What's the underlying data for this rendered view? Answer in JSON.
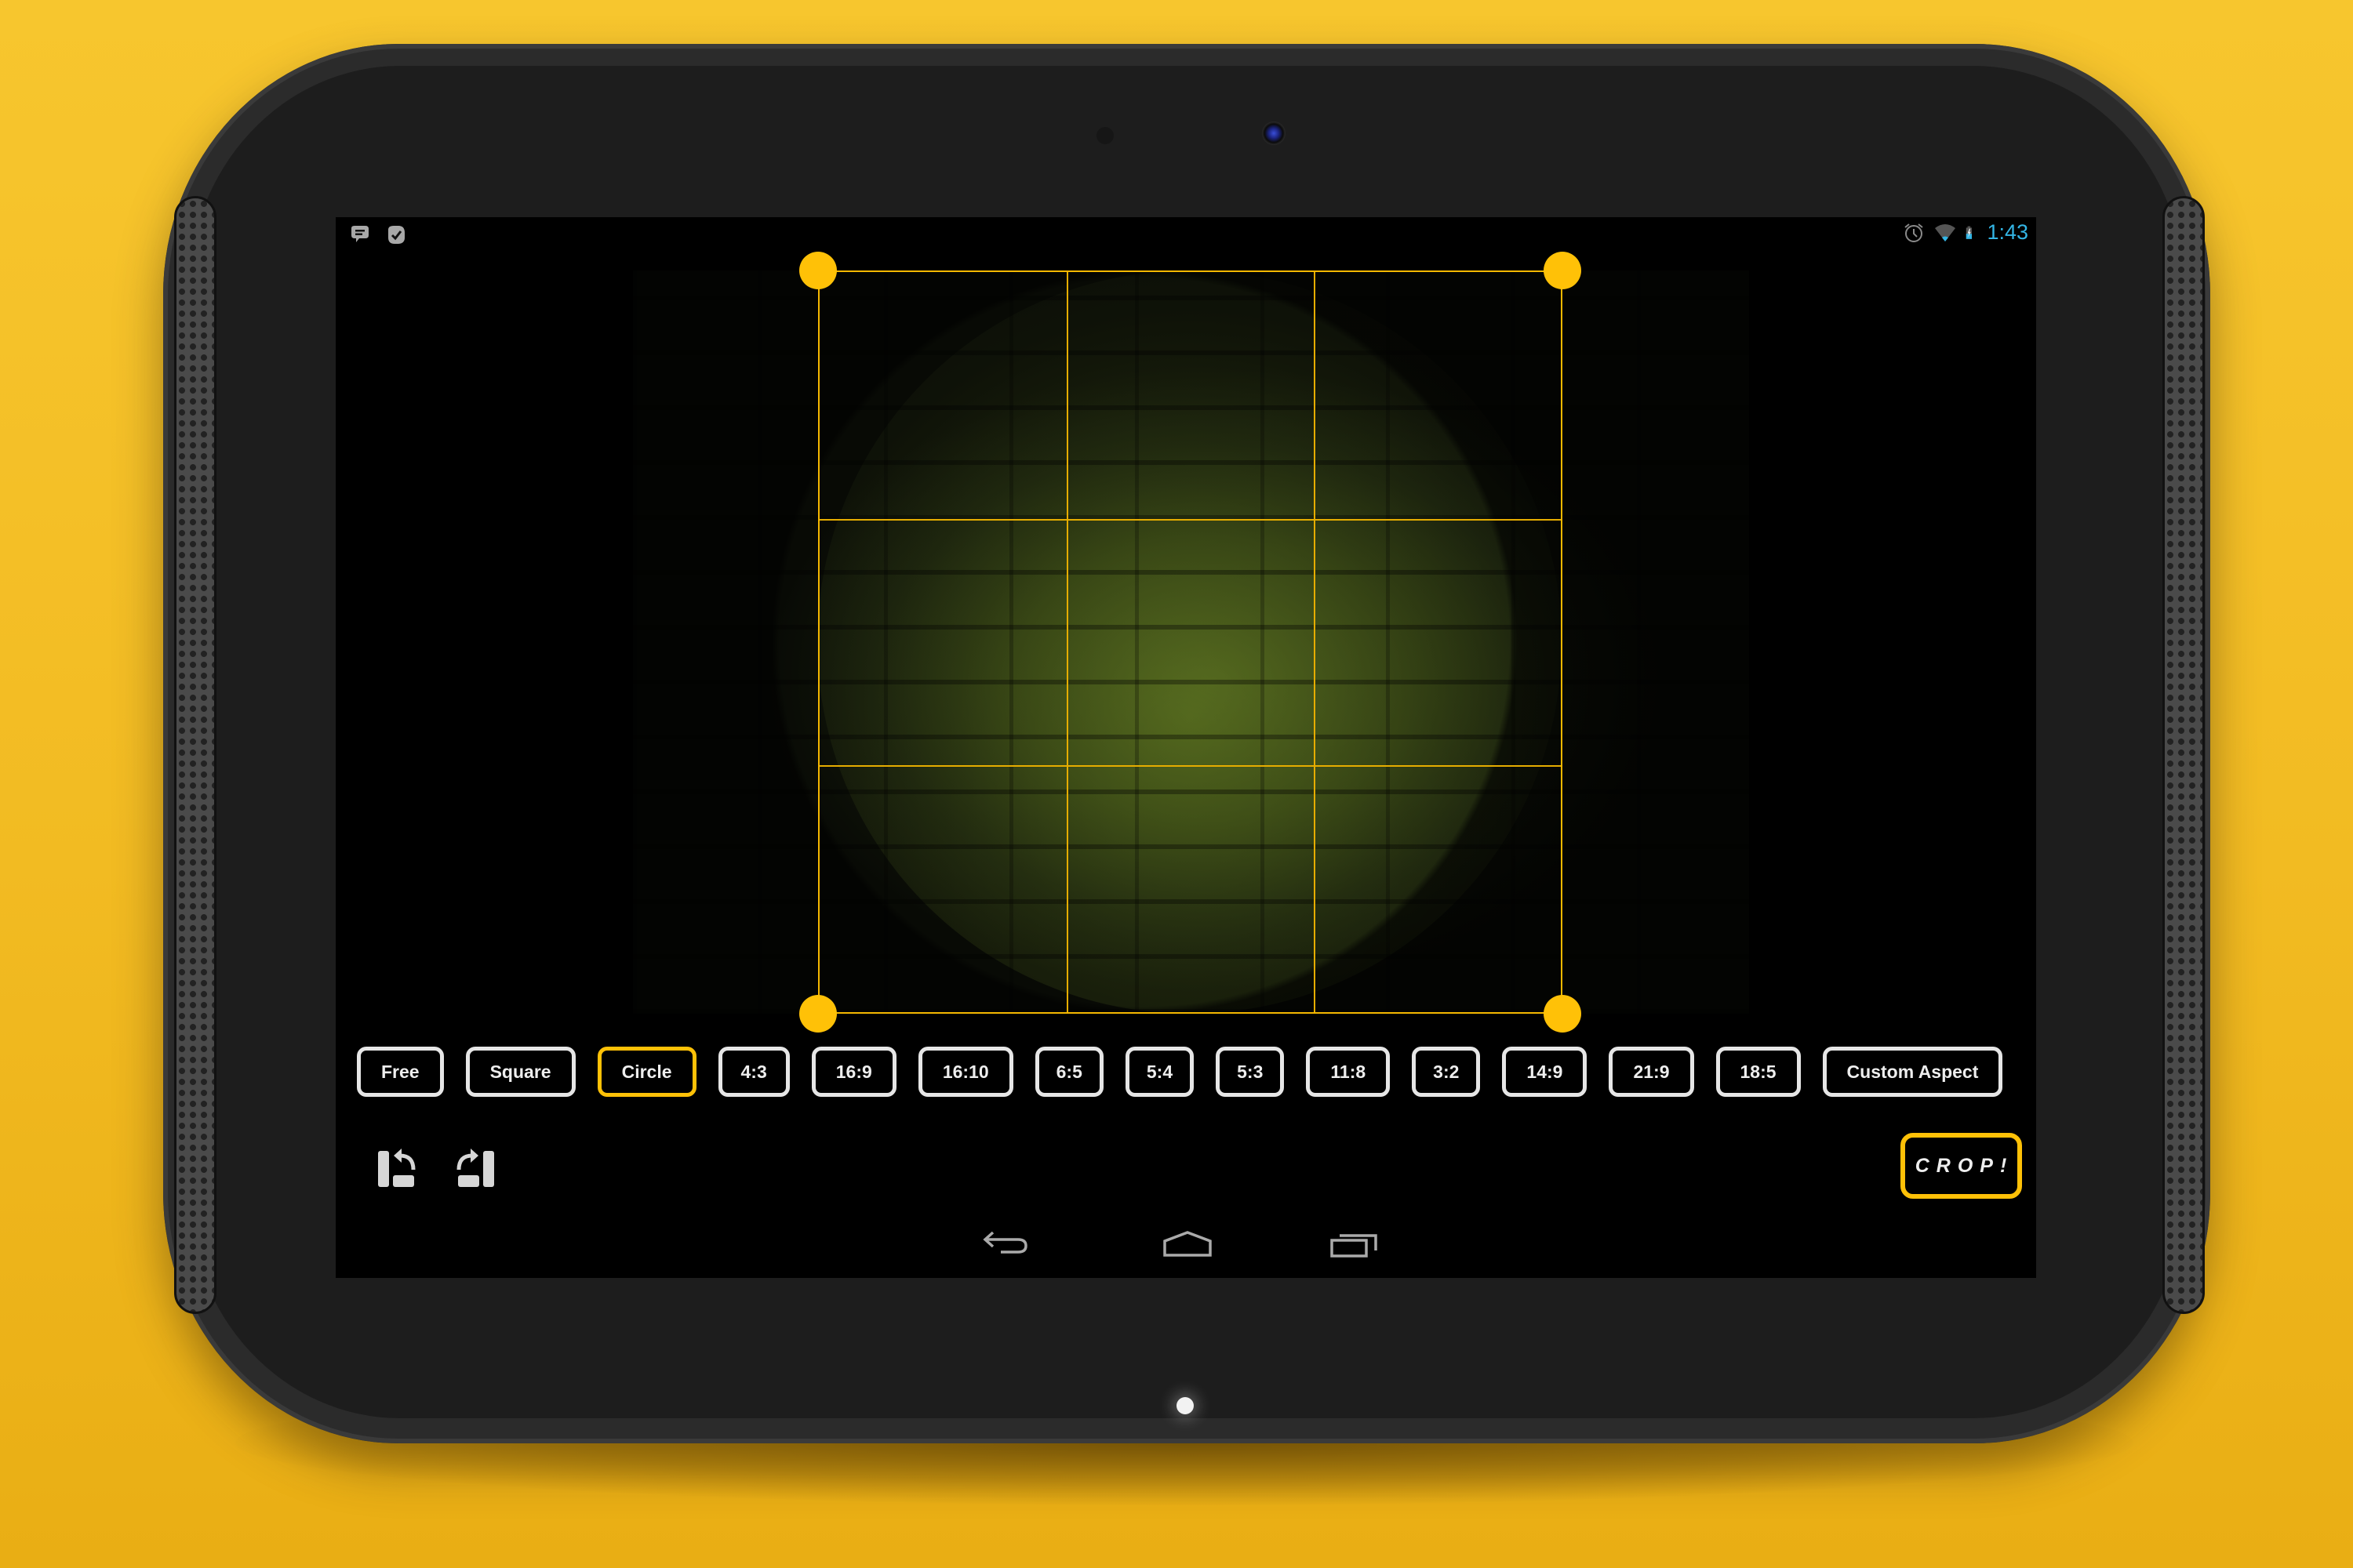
{
  "device": {
    "type": "android-tablet",
    "background_color": "#f5bf26",
    "accent_color": "#ffc107"
  },
  "status_bar": {
    "notifications": [
      "message-icon",
      "check-badge-icon"
    ],
    "system_icons": [
      "alarm-icon",
      "wifi-icon",
      "battery-charging-icon"
    ],
    "time": "1:43",
    "time_color": "#33b5e5"
  },
  "editor": {
    "crop_shape": "Circle",
    "grid": "rule-of-thirds"
  },
  "aspect_options": [
    {
      "label": "Free",
      "selected": false
    },
    {
      "label": "Square",
      "selected": false
    },
    {
      "label": "Circle",
      "selected": true
    },
    {
      "label": "4:3",
      "selected": false
    },
    {
      "label": "16:9",
      "selected": false
    },
    {
      "label": "16:10",
      "selected": false
    },
    {
      "label": "6:5",
      "selected": false
    },
    {
      "label": "5:4",
      "selected": false
    },
    {
      "label": "5:3",
      "selected": false
    },
    {
      "label": "11:8",
      "selected": false
    },
    {
      "label": "3:2",
      "selected": false
    },
    {
      "label": "14:9",
      "selected": false
    },
    {
      "label": "21:9",
      "selected": false
    },
    {
      "label": "18:5",
      "selected": false
    },
    {
      "label": "Custom Aspect",
      "selected": false
    }
  ],
  "toolbar": {
    "rotate_left_icon": "rotate-left-icon",
    "rotate_right_icon": "rotate-right-icon",
    "crop_label": "CROP!"
  },
  "nav_bar": [
    "back-icon",
    "home-icon",
    "recents-icon"
  ]
}
